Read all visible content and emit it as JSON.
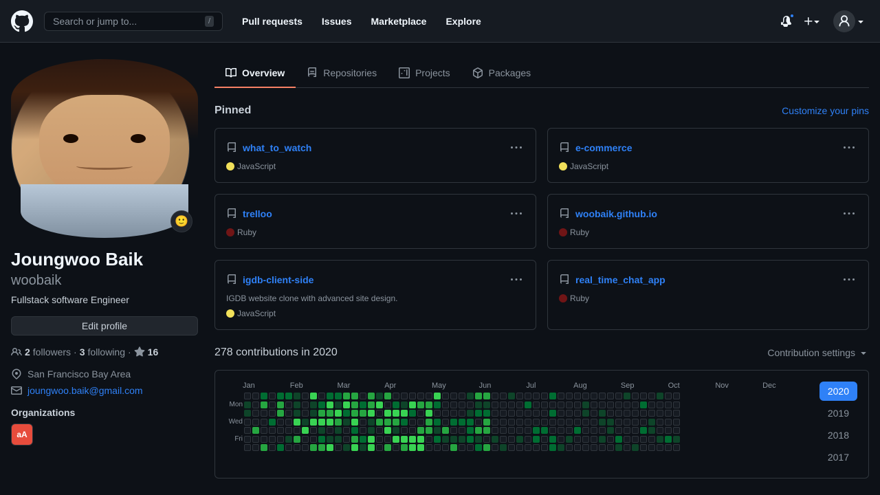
{
  "header": {
    "search_placeholder": "Search or jump to...",
    "search_shortcut": "/",
    "nav_items": [
      "Pull requests",
      "Issues",
      "Marketplace",
      "Explore"
    ],
    "plus_label": "+",
    "avatar_alt": "User avatar"
  },
  "profile_nav": {
    "items": [
      {
        "label": "Overview",
        "icon": "book",
        "active": true
      },
      {
        "label": "Repositories",
        "icon": "repo"
      },
      {
        "label": "Projects",
        "icon": "project"
      },
      {
        "label": "Packages",
        "icon": "package"
      }
    ]
  },
  "user": {
    "name": "Joungwoo Baik",
    "username": "woobaik",
    "bio": "Fullstack software Engineer",
    "edit_label": "Edit profile",
    "followers": 2,
    "following": 3,
    "stars": 16,
    "followers_label": "followers",
    "following_label": "following",
    "location": "San Francisco Bay Area",
    "email": "joungwoo.baik@gmail.com",
    "org_title": "Organizations"
  },
  "pinned": {
    "title": "Pinned",
    "customize_label": "Customize your pins",
    "cards": [
      {
        "name": "what_to_watch",
        "language": "JavaScript",
        "lang_class": "js",
        "description": ""
      },
      {
        "name": "e-commerce",
        "language": "JavaScript",
        "lang_class": "js",
        "description": ""
      },
      {
        "name": "trelloo",
        "language": "Ruby",
        "lang_class": "ruby",
        "description": ""
      },
      {
        "name": "woobaik.github.io",
        "language": "Ruby",
        "lang_class": "ruby",
        "description": ""
      },
      {
        "name": "igdb-client-side",
        "language": "JavaScript",
        "lang_class": "js",
        "description": "IGDB website clone with advanced site design."
      },
      {
        "name": "real_time_chat_app",
        "language": "Ruby",
        "lang_class": "ruby",
        "description": ""
      }
    ]
  },
  "contributions": {
    "title": "278 contributions in 2020",
    "settings_label": "Contribution settings",
    "months": [
      "Jan",
      "Feb",
      "Mar",
      "Apr",
      "May",
      "Jun",
      "Jul",
      "Aug",
      "Sep",
      "Oct",
      "Nov",
      "Dec"
    ],
    "day_labels": [
      "",
      "Mon",
      "",
      "Wed",
      "",
      "Fri",
      ""
    ],
    "years": [
      "2020",
      "2019",
      "2018",
      "2017"
    ]
  }
}
